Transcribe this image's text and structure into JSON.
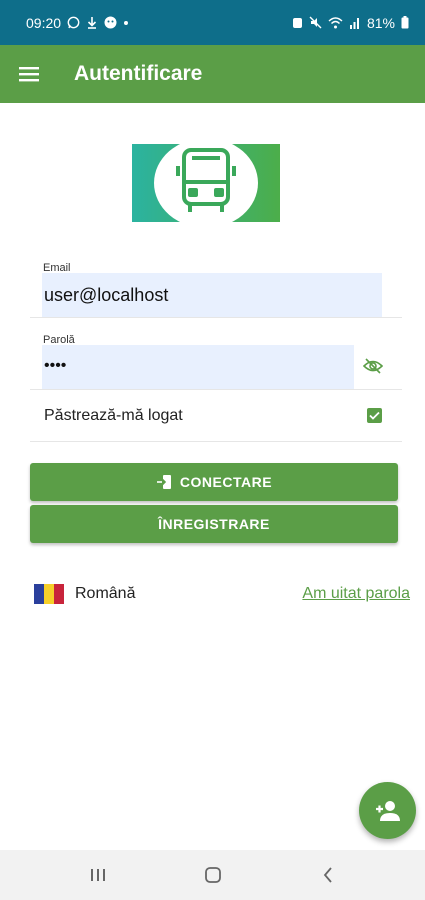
{
  "status_bar": {
    "time": "09:20",
    "battery": "81%",
    "left_icons": [
      "whatsapp-icon",
      "download-icon",
      "face-icon",
      "dot-icon"
    ],
    "right_icons": [
      "alarm-icon",
      "mute-icon",
      "wifi-icon",
      "signal-icon",
      "battery-icon"
    ]
  },
  "app_bar": {
    "title": "Autentificare",
    "menu_icon": "menu-icon"
  },
  "logo": {
    "icon": "bus-icon",
    "colors": [
      "#2bb3a0",
      "#4cae4a"
    ]
  },
  "form": {
    "email": {
      "label": "Email",
      "value": "user@localhost"
    },
    "password": {
      "label": "Parolă",
      "value": "••••",
      "toggle_icon": "eye-off-icon"
    },
    "remember": {
      "label": "Păstrează-mă logat",
      "checked": true
    }
  },
  "buttons": {
    "login": {
      "label": "CONECTARE",
      "icon": "login-icon"
    },
    "register": {
      "label": "ÎNREGISTRARE"
    }
  },
  "language": {
    "label": "Română",
    "flag_colors": [
      "#2a3f9c",
      "#f6cf29",
      "#c8243b"
    ]
  },
  "forgot_password": "Am uitat parola",
  "fab": {
    "icon": "add-person-icon"
  },
  "nav_bar": {
    "icons": [
      "recents-icon",
      "home-icon",
      "back-icon"
    ]
  },
  "colors": {
    "primary": "#5b9e47",
    "status_bar": "#0e6e8a",
    "field_fill": "#e8f0fe"
  }
}
